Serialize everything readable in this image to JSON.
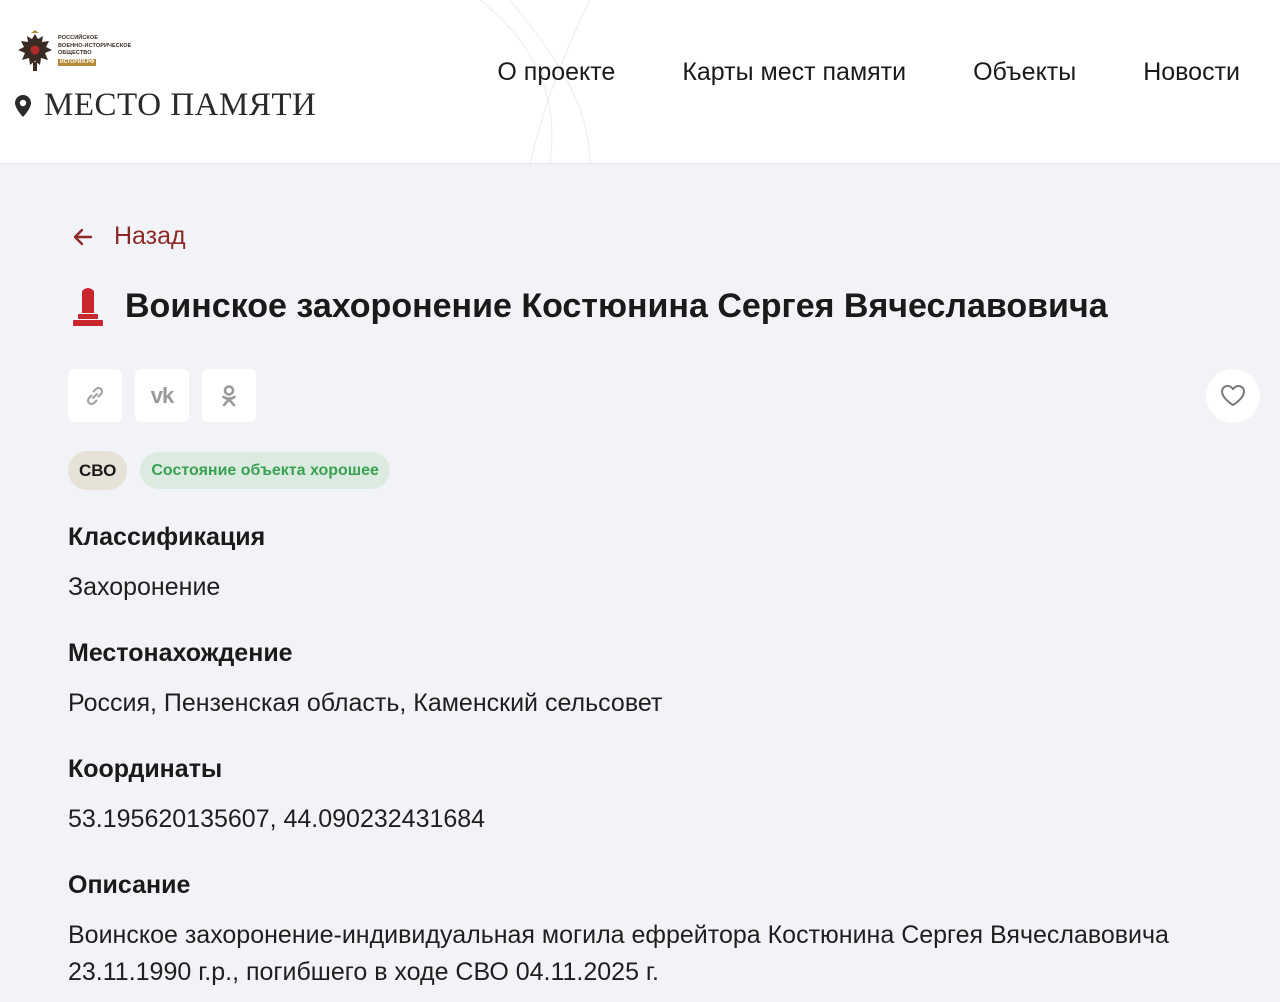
{
  "header": {
    "org_lines": [
      "РОССИЙСКОЕ",
      "ВОЕННО-ИСТОРИЧЕСКОЕ",
      "ОБЩЕСТВО"
    ],
    "org_badge": "ИСТОРИЯ.РФ",
    "site_title": "МЕСТО ПАМЯТИ",
    "nav": [
      "О проекте",
      "Карты мест памяти",
      "Объекты",
      "Новости"
    ]
  },
  "back": {
    "label": "Назад",
    "icon": "arrow-left-icon"
  },
  "object": {
    "title": "Воинское захоронение Костюнина Сергея Вячеславовича",
    "icon": "monument-icon",
    "share": [
      {
        "name": "copy-link",
        "icon": "link-icon"
      },
      {
        "name": "vk",
        "icon": "vk-icon",
        "text": "vk"
      },
      {
        "name": "odnoklassniki",
        "icon": "ok-icon"
      }
    ],
    "favorite_icon": "heart-icon",
    "badges": {
      "category": "СВО",
      "state": "Состояние объекта хорошее"
    },
    "fields": [
      {
        "label": "Классификация",
        "value": "Захоронение"
      },
      {
        "label": "Местонахождение",
        "value": "Россия, Пензенская область, Каменский сельсовет"
      },
      {
        "label": "Координаты",
        "value": "53.195620135607, 44.090232431684"
      },
      {
        "label": "Описание",
        "value": "Воинское захоронение-индивидуальная могила ефрейтора Костюнина Сергея Вячеславовича 23.11.1990 г.р., погибшего в ходе СВО 04.11.2025 г."
      }
    ]
  },
  "colors": {
    "accent": "#8b2a26",
    "monument": "#c8252c",
    "state_text": "#3aa153",
    "state_bg": "#dcebe0",
    "category_bg": "#e7e2d8",
    "page_bg": "#f2f3f6"
  }
}
